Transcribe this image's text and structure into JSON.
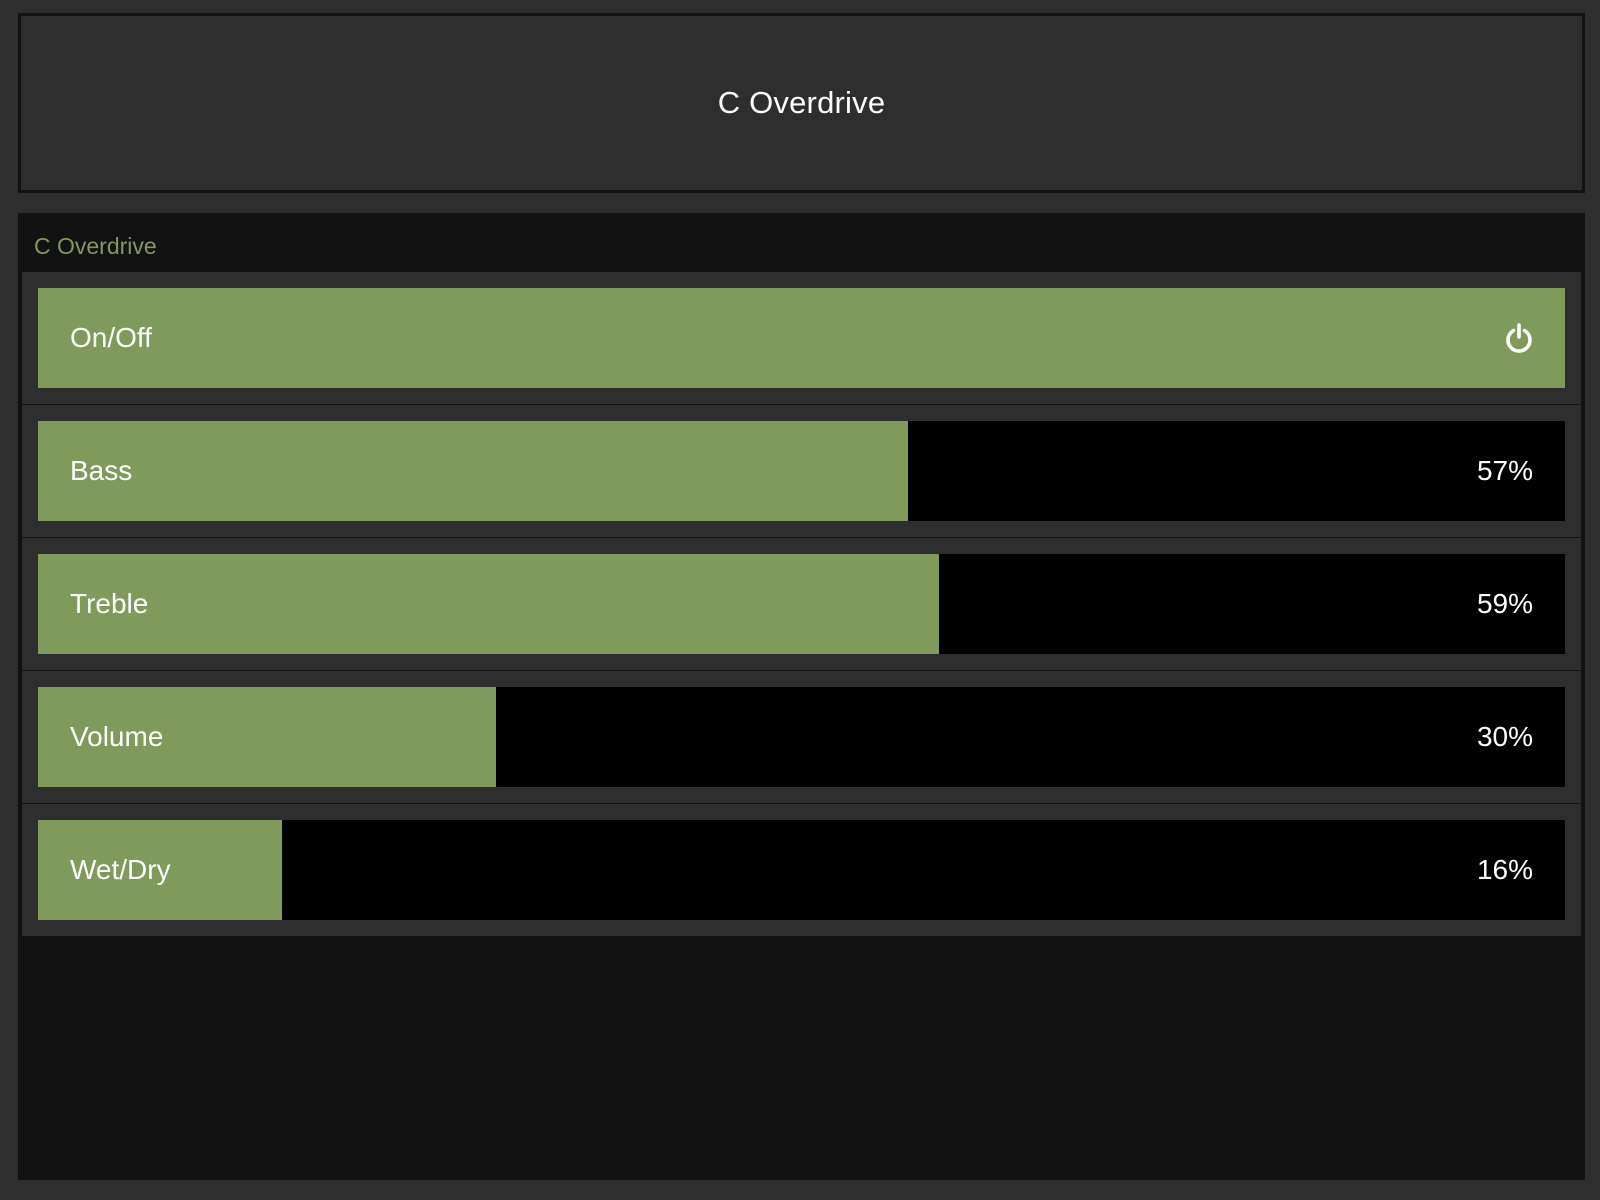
{
  "header": {
    "title": "C Overdrive"
  },
  "panel": {
    "title": "C Overdrive",
    "onoff": {
      "label": "On/Off",
      "state": "on",
      "icon": "power-icon"
    },
    "sliders": [
      {
        "label": "Bass",
        "value_text": "57%",
        "fraction": 0.57
      },
      {
        "label": "Treble",
        "value_text": "59%",
        "fraction": 0.59
      },
      {
        "label": "Volume",
        "value_text": "30%",
        "fraction": 0.3
      },
      {
        "label": "Wet/Dry",
        "value_text": "16%",
        "fraction": 0.16
      }
    ]
  },
  "colors": {
    "accent": "#7f9a5a",
    "background": "#2e2e2e",
    "panel": "#121212",
    "track": "#000000",
    "text": "#ffffff"
  }
}
